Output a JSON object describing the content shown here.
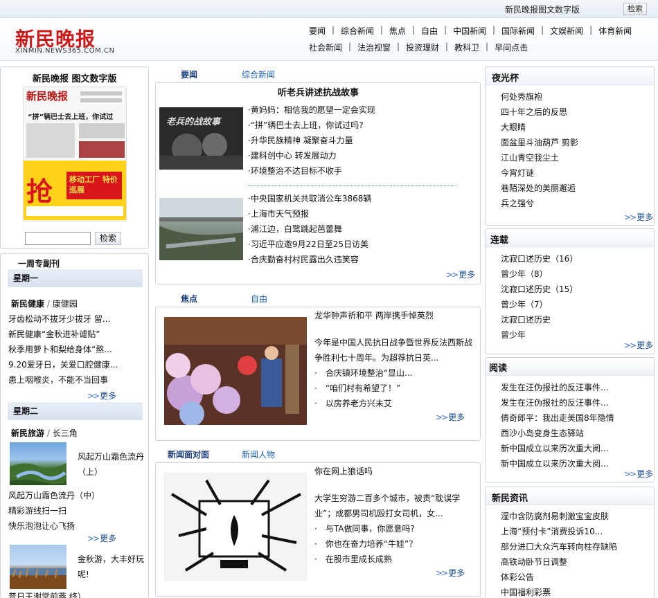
{
  "topbar": {
    "digital_label": "新民晚报图文数字版",
    "search_label": "检索"
  },
  "header": {
    "logo_text": "新民晚报",
    "logo_url": "XINMIN.NEWS365.COM.CN",
    "nav_row1": [
      "要闻",
      "综合新闻",
      "焦点",
      "自由",
      "中国新闻",
      "国际新闻",
      "文娱新闻",
      "体育新闻"
    ],
    "nav_row2": [
      "社会新闻",
      "法治视窗",
      "投资理财",
      "教科卫",
      "早间点击"
    ]
  },
  "left": {
    "paper_title": "新民晚报 图文数字版",
    "paper_masthead": "新民晚报",
    "paper_headline": "“拼”辆巴士去上班，你试过吗？",
    "paper_ad_char": "抢",
    "paper_ad_text": "移动工厂 特价巡展",
    "search_label": "检索",
    "weekly_title": "一周专副刊",
    "monday": "星期一",
    "health_cat": "新民健康",
    "health_sub": "康健园",
    "health_items": [
      "牙齿松动不拔牙少拔牙 留...",
      "新民健康“金秋进补谑贴”",
      "秋季用萝卜和梨给身体“熬...",
      "9.20爱牙日，关爱口腔健康...",
      "患上咽喉炎，不能不当回事"
    ],
    "tuesday": "星期二",
    "travel_cat": "新民旅游",
    "travel_sub": "长三角",
    "travel_feature1": "风起万山霜色流丹（上）",
    "travel_items": [
      "风起万山霜色流丹（中）",
      "精彩游线扫一扫",
      "快乐泡泡让心飞扬"
    ],
    "travel_feature2": "金秋游，大丰好玩呢!",
    "travel_cut": "昔日王谢堂前燕 终）",
    "more": "更多"
  },
  "middle": {
    "yaowen_tab": "要闻",
    "zonghe_tab": "综合新闻",
    "block1_title": "听老兵讲述抗战故事",
    "block1_photo_text": "老兵的战故事",
    "block1_items": [
      "黄妈妈：相信我的愿望一定会实现",
      "“拼”辆巴士去上班，你试过吗?",
      "升华民族精神 凝聚奋斗力量",
      "建科创中心 转发展动力",
      "环境整治不达目标不收手"
    ],
    "block2_items": [
      "中央国家机关共取消公车3868辆",
      "上海市天气预报",
      "浦江边，白鹭跳起芭蕾舞",
      "习近平应邀9月22日至25日访美",
      "合庆勤奋村村民露出久违笑容"
    ],
    "jiaodian_tab": "焦点",
    "ziyou_tab": "自由",
    "focus_headline": "龙华钟声祈和平 两岸携手悼英烈",
    "focus_desc": "今年是中国人民抗日战争暨世界反法西斯战争胜利七十周年。为超荐抗日英...",
    "focus_items": [
      "合庆镇环境整治“显山...",
      "“咱们村有希望了！”",
      "以房养老方兴未艾"
    ],
    "face_tab": "新闻面对面",
    "people_tab": "新闻人物",
    "face_headline": "你在网上狼话吗",
    "face_desc": "大学生穷游二百多个城市，被责“耽误学业”；成都男司机殴打女司机，女...",
    "face_items": [
      "与TA做同事，你愿意吗?",
      "你也在奋力培养“牛娃”？",
      "在股市里成长成熟"
    ],
    "more": "更多"
  },
  "right": {
    "yeguang_title": "夜光杯",
    "yeguang_items": [
      "何处秀旗袍",
      "四十年之后的反思",
      "大眼睛",
      "面盆里斗油葫芦 剪影",
      "江山青空我尘土",
      "今宵灯谜",
      "巷陌深处的美丽邂逅",
      "兵之强兮"
    ],
    "lianzai_title": "连载",
    "lianzai_items": [
      "沈寂口述历史（16）",
      "曾少年（8）",
      "沈寂口述历史（15）",
      "曾少年（7）",
      "沈寂口述历史",
      "曾少年"
    ],
    "yuedu_title": "阅读",
    "yuedu_items": [
      "发生在汪伪报社的反汪事件...",
      "发生在汪伪报社的反汪事件...",
      "倩奇郎平：我出走美国8年隐情",
      "西沙小岛变身生态驿站",
      "新中国成立以来历次重大阅...",
      "新中国成立以来历次重大阅..."
    ],
    "zixun_title": "新民资讯",
    "zixun_items": [
      "湿巾含防腐剂易刺激宝宝皮肤",
      "上海“预付卡”消费投诉10...",
      "部分进口大众汽车转向柱存缺陷",
      "高铁动卧节日调整",
      "体彩公告",
      "中国福利彩票"
    ],
    "more": "更多"
  },
  "colors": {
    "logo_red": "#cc1a1a",
    "link_blue": "#1a5fb4",
    "panel_border": "#c9d3de"
  }
}
